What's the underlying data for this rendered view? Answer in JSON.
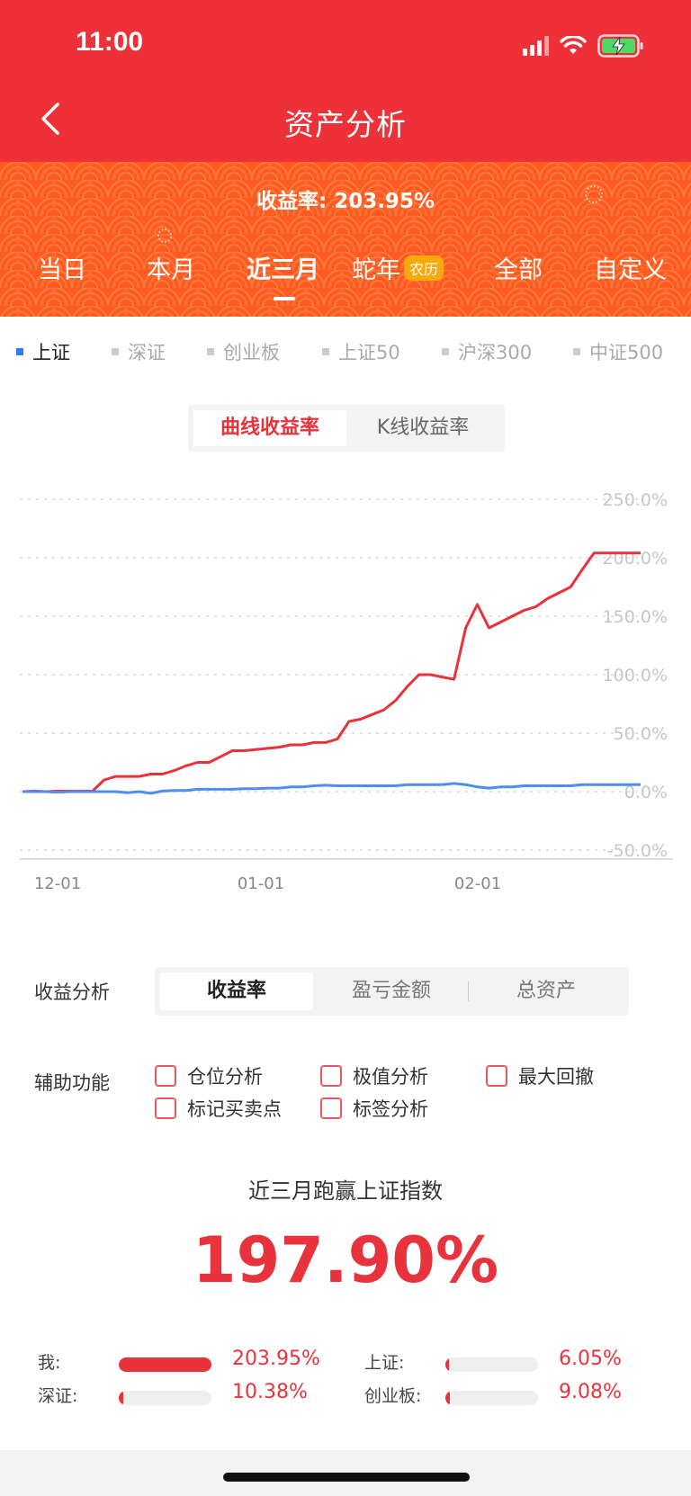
{
  "status_bar": {
    "time": "11:00"
  },
  "nav": {
    "title": "资产分析",
    "back_icon": "chevron-left-icon"
  },
  "summary": {
    "return_rate_text": "收益率: 203.95%"
  },
  "period_tabs": [
    {
      "label": "当日",
      "active": false
    },
    {
      "label": "本月",
      "active": false
    },
    {
      "label": "近三月",
      "active": true
    },
    {
      "label": "蛇年",
      "badge": "农历",
      "active": false
    },
    {
      "label": "全部",
      "active": false
    },
    {
      "label": "自定义",
      "active": false
    }
  ],
  "index_tabs": [
    {
      "label": "上证",
      "active": true
    },
    {
      "label": "深证",
      "active": false
    },
    {
      "label": "创业板",
      "active": false
    },
    {
      "label": "上证50",
      "active": false
    },
    {
      "label": "沪深300",
      "active": false
    },
    {
      "label": "中证500",
      "active": false
    }
  ],
  "chart_toggle": {
    "curve": "曲线收益率",
    "kline": "K线收益率"
  },
  "chart_data": {
    "type": "line",
    "y_ticks": [
      "250.0%",
      "200.0%",
      "150.0%",
      "100.0%",
      "50.0%",
      "0.0%",
      "-50.0%"
    ],
    "ylim": [
      -50,
      250
    ],
    "x_ticks": [
      "12-01",
      "01-01",
      "02-01"
    ],
    "grid": true,
    "series": [
      {
        "color": "#e8333c",
        "values": [
          0,
          0.5,
          0,
          0.5,
          0.5,
          0.5,
          0.5,
          10,
          13,
          13,
          13,
          15,
          15,
          18,
          22,
          25,
          25,
          30,
          35,
          35,
          36,
          37,
          38,
          40,
          40,
          42,
          42,
          45,
          60,
          62,
          66,
          70,
          78,
          90,
          100,
          100,
          98,
          96,
          140,
          160,
          140,
          145,
          150,
          155,
          158,
          165,
          170,
          175,
          190,
          204,
          204,
          204,
          204,
          204
        ]
      },
      {
        "color": "#4d8ef0",
        "values": [
          0,
          0,
          0,
          -0.5,
          0,
          0,
          0,
          0,
          0,
          -1,
          0,
          -1.5,
          0.5,
          1,
          1,
          2,
          2,
          2,
          2,
          2.5,
          2.5,
          3,
          3,
          4,
          4,
          5,
          5.5,
          5,
          5,
          5,
          5,
          5,
          5,
          6,
          6,
          6,
          6,
          7,
          6,
          4,
          3,
          4,
          4,
          5,
          5,
          5,
          5,
          5,
          6,
          6,
          6,
          6,
          6,
          6.05
        ]
      }
    ]
  },
  "analysis": {
    "label": "收益分析",
    "options": [
      {
        "label": "收益率",
        "active": true
      },
      {
        "label": "盈亏金额",
        "active": false
      },
      {
        "label": "总资产",
        "active": false
      }
    ]
  },
  "aux": {
    "label": "辅助功能",
    "items": [
      "仓位分析",
      "极值分析",
      "最大回撤",
      "标记买卖点",
      "标签分析"
    ]
  },
  "beat": {
    "title": "近三月跑赢上证指数",
    "value": "197.90%"
  },
  "compare": [
    {
      "label": "我:",
      "value": "203.95%",
      "fill": 1.0
    },
    {
      "label": "上证:",
      "value": "6.05%",
      "fill": 0.03
    },
    {
      "label": "深证:",
      "value": "10.38%",
      "fill": 0.05
    },
    {
      "label": "创业板:",
      "value": "9.08%",
      "fill": 0.045
    }
  ]
}
